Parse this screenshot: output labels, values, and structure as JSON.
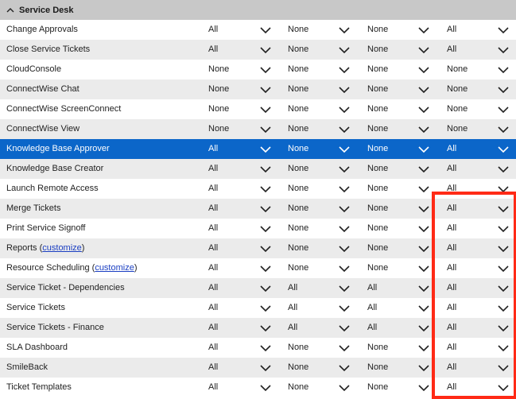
{
  "section": {
    "title": "Service Desk"
  },
  "rows": [
    {
      "label": "Change Approvals",
      "values": [
        "All",
        "None",
        "None",
        "All"
      ]
    },
    {
      "label": "Close Service Tickets",
      "values": [
        "All",
        "None",
        "None",
        "All"
      ]
    },
    {
      "label": "CloudConsole",
      "values": [
        "None",
        "None",
        "None",
        "None"
      ]
    },
    {
      "label": "ConnectWise Chat",
      "values": [
        "None",
        "None",
        "None",
        "None"
      ]
    },
    {
      "label": "ConnectWise ScreenConnect",
      "values": [
        "None",
        "None",
        "None",
        "None"
      ]
    },
    {
      "label": "ConnectWise View",
      "values": [
        "None",
        "None",
        "None",
        "None"
      ]
    },
    {
      "label": "Knowledge Base Approver",
      "values": [
        "All",
        "None",
        "None",
        "All"
      ],
      "selected": true
    },
    {
      "label": "Knowledge Base Creator",
      "values": [
        "All",
        "None",
        "None",
        "All"
      ]
    },
    {
      "label": "Launch Remote Access",
      "values": [
        "All",
        "None",
        "None",
        "All"
      ]
    },
    {
      "label": "Merge Tickets",
      "values": [
        "All",
        "None",
        "None",
        "All"
      ]
    },
    {
      "label": "Print Service Signoff",
      "values": [
        "All",
        "None",
        "None",
        "All"
      ]
    },
    {
      "label": "Reports",
      "link": "customize",
      "values": [
        "All",
        "None",
        "None",
        "All"
      ]
    },
    {
      "label": "Resource Scheduling",
      "link": "customize",
      "values": [
        "All",
        "None",
        "None",
        "All"
      ]
    },
    {
      "label": "Service Ticket - Dependencies",
      "values": [
        "All",
        "All",
        "All",
        "All"
      ]
    },
    {
      "label": "Service Tickets",
      "values": [
        "All",
        "All",
        "All",
        "All"
      ]
    },
    {
      "label": "Service Tickets - Finance",
      "values": [
        "All",
        "All",
        "All",
        "All"
      ]
    },
    {
      "label": "SLA Dashboard",
      "values": [
        "All",
        "None",
        "None",
        "All"
      ]
    },
    {
      "label": "SmileBack",
      "values": [
        "All",
        "None",
        "None",
        "All"
      ]
    },
    {
      "label": "Ticket Templates",
      "values": [
        "All",
        "None",
        "None",
        "All"
      ]
    }
  ],
  "highlight_color": "#ff2a16",
  "selected_color": "#0b66c9"
}
